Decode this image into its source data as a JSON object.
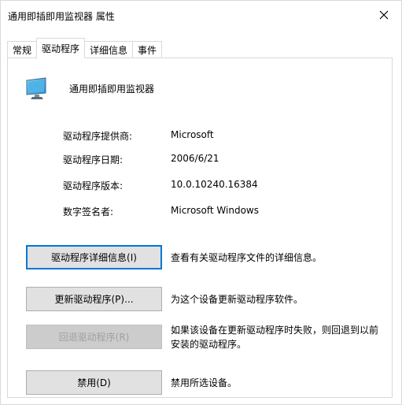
{
  "window": {
    "title": "通用即插即用监视器 属性",
    "close_glyph": "✕"
  },
  "tabs": [
    {
      "label": "常规",
      "active": false
    },
    {
      "label": "驱动程序",
      "active": true
    },
    {
      "label": "详细信息",
      "active": false
    },
    {
      "label": "事件",
      "active": false
    }
  ],
  "device": {
    "name": "通用即插即用监视器",
    "icon": "monitor-icon"
  },
  "properties": [
    {
      "label": "驱动程序提供商:",
      "value": "Microsoft"
    },
    {
      "label": "驱动程序日期:",
      "value": "2006/6/21"
    },
    {
      "label": "驱动程序版本:",
      "value": "10.0.10240.16384"
    },
    {
      "label": "数字签名者:",
      "value": "Microsoft Windows"
    }
  ],
  "actions": [
    {
      "label": "驱动程序详细信息(I)",
      "description": "查看有关驱动程序文件的详细信息。",
      "enabled": true,
      "focused": true
    },
    {
      "label": "更新驱动程序(P)...",
      "description": "为这个设备更新驱动程序软件。",
      "enabled": true,
      "focused": false
    },
    {
      "label": "回退驱动程序(R)",
      "description": "如果该设备在更新驱动程序时失败，则回退到以前安装的驱动程序。",
      "enabled": false,
      "focused": false
    },
    {
      "label": "禁用(D)",
      "description": "禁用所选设备。",
      "enabled": true,
      "focused": false
    }
  ],
  "colors": {
    "focus_border": "#0078d7",
    "button_bg": "#e1e1e1",
    "disabled_text": "#a0a0a0",
    "border": "#d9d9d9"
  }
}
